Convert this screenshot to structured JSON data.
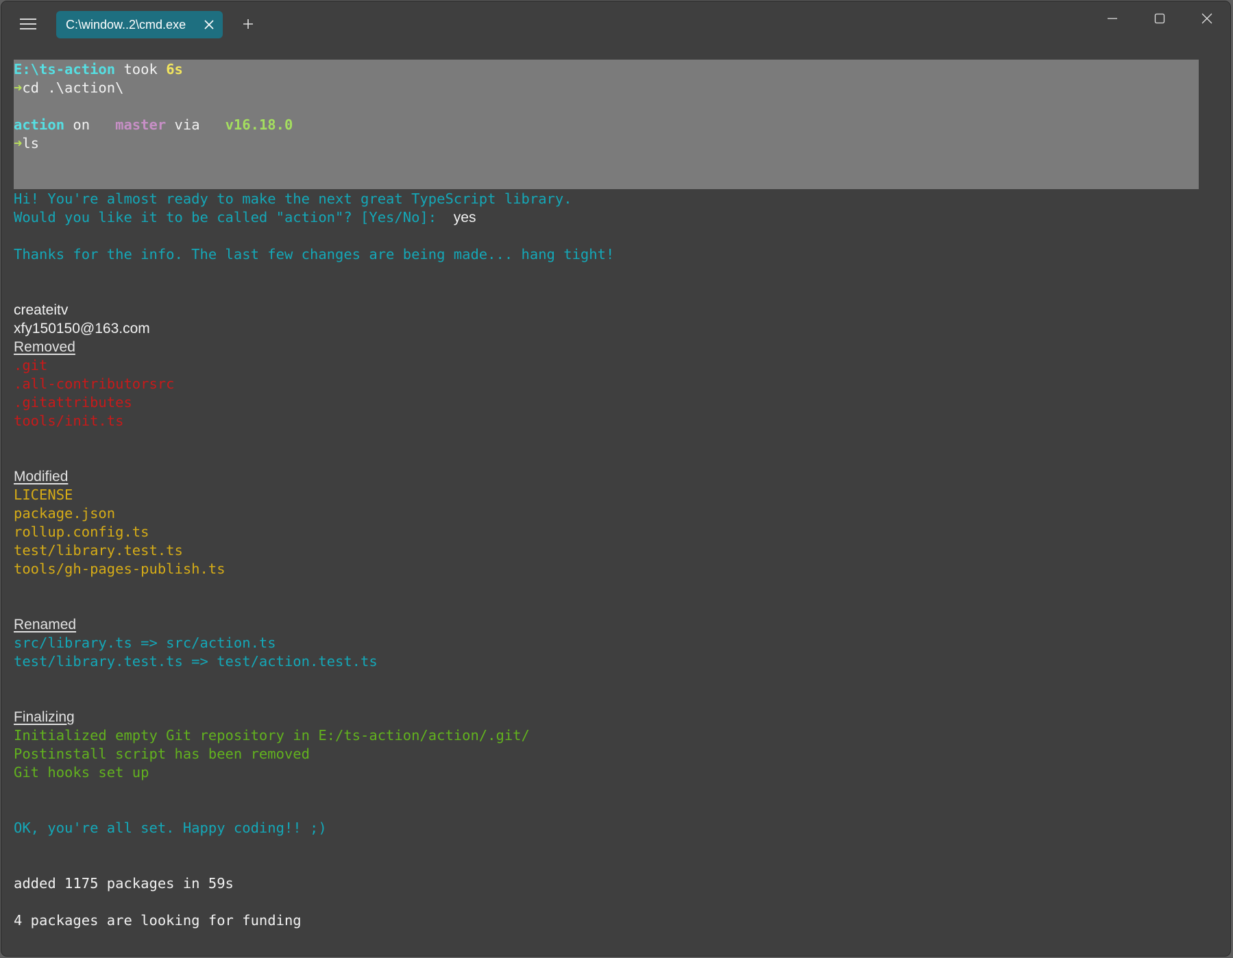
{
  "window": {
    "tab_title": "C:\\window..2\\cmd.exe",
    "icons": {
      "menu": "hamburger-menu-icon",
      "tab_close": "close-icon",
      "new_tab": "plus-icon",
      "minimize": "minimize-icon",
      "maximize": "maximize-icon",
      "close": "close-icon"
    }
  },
  "colors": {
    "background": "#3f3f3f",
    "tab_active": "#1e6f80",
    "selection": "#7b7b7b",
    "cyan": "#56dfe3",
    "teal": "#14a8b8",
    "red": "#c81a1a",
    "gold": "#d6ac17",
    "green": "#62b21e"
  },
  "terminal": {
    "prompt1": {
      "path_a": "E:\\t",
      "path_b": "s-action",
      "took": " took ",
      "time": "6s"
    },
    "cmd1": {
      "arrow": "➜",
      "command": "cd .\\action\\"
    },
    "prompt2": {
      "dir": "action",
      "on": " on ",
      "branch": "  master",
      "via": " via ",
      "node": "  v16.18.0"
    },
    "cmd2": {
      "arrow": "➜",
      "command": "ls"
    },
    "greeting": "Hi! You're almost ready to make the next great TypeScript library.",
    "question": "Would you like it to be called \"action\"? [Yes/No]: ",
    "answer": "yes",
    "thanks": "Thanks for the info. The last few changes are being made... hang tight!",
    "user_name": "createitv",
    "user_email": "xfy150150@163.com",
    "removed": {
      "heading": "Removed",
      "items": [
        ".git",
        ".all-contributorsrc",
        ".gitattributes",
        "tools/init.ts"
      ]
    },
    "modified": {
      "heading": "Modified",
      "items": [
        "LICENSE",
        "package.json",
        "rollup.config.ts",
        "test/library.test.ts",
        "tools/gh-pages-publish.ts"
      ]
    },
    "renamed": {
      "heading": "Renamed",
      "items": [
        "src/library.ts => src/action.ts",
        "test/library.test.ts => test/action.test.ts"
      ]
    },
    "finalizing": {
      "heading": "Finalizing",
      "items": [
        "Initialized empty Git repository in E:/ts-action/action/.git/",
        "Postinstall script has been removed",
        "Git hooks set up"
      ]
    },
    "done": "OK, you're all set. Happy coding!! ;)",
    "added": "added 1175 packages in 59s",
    "funding": "4 packages are looking for funding"
  }
}
